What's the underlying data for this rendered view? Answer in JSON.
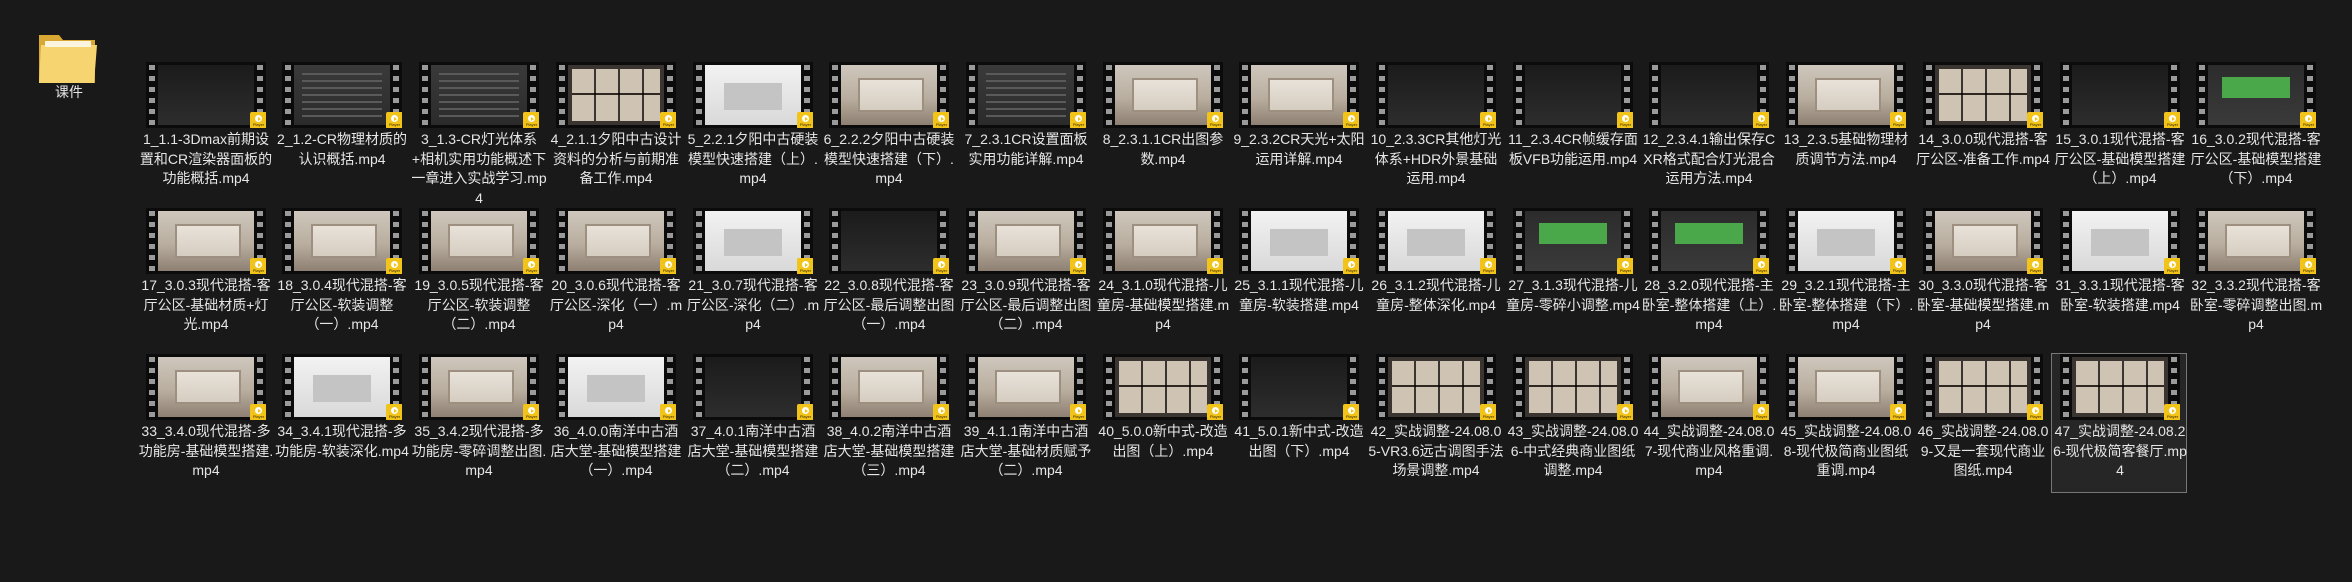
{
  "folder": {
    "name": "课件",
    "icon": "folder-icon"
  },
  "badge_text": "Player",
  "selected_index": 46,
  "files": [
    {
      "name": "1_1.1-3Dmax前期设置和CR渲染器面板的功能概括.mp4",
      "scene": "dark"
    },
    {
      "name": "2_1.2-CR物理材质的认识概括.mp4",
      "scene": "ui"
    },
    {
      "name": "3_1.3-CR灯光体系+相机实用功能概述下一章进入实战学习.mp4",
      "scene": "ui"
    },
    {
      "name": "4_2.1.1夕阳中古设计资料的分析与前期准备工作.mp4",
      "scene": "grid"
    },
    {
      "name": "5_2.2.1夕阳中古硬装模型快速搭建（上）.mp4",
      "scene": "white"
    },
    {
      "name": "6_2.2.2夕阳中古硬装模型快速搭建（下）.mp4",
      "scene": "room"
    },
    {
      "name": "7_2.3.1CR设置面板实用功能详解.mp4",
      "scene": "ui"
    },
    {
      "name": "8_2.3.1.1CR出图参数.mp4",
      "scene": "room"
    },
    {
      "name": "9_2.3.2CR天光+太阳运用详解.mp4",
      "scene": "room"
    },
    {
      "name": "10_2.3.3CR其他灯光体系+HDR外景基础运用.mp4",
      "scene": "dark"
    },
    {
      "name": "11_2.3.4CR帧缓存面板VFB功能运用.mp4",
      "scene": "dark"
    },
    {
      "name": "12_2.3.4.1输出保存CXR格式配合灯光混合运用方法.mp4",
      "scene": "dark"
    },
    {
      "name": "13_2.3.5基础物理材质调节方法.mp4",
      "scene": "room"
    },
    {
      "name": "14_3.0.0现代混搭-客厅公区-准备工作.mp4",
      "scene": "grid"
    },
    {
      "name": "15_3.0.1现代混搭-客厅公区-基础模型搭建（上）.mp4",
      "scene": "dark"
    },
    {
      "name": "16_3.0.2现代混搭-客厅公区-基础模型搭建（下）.mp4",
      "scene": "green"
    },
    {
      "name": "17_3.0.3现代混搭-客厅公区-基础材质+灯光.mp4",
      "scene": "room"
    },
    {
      "name": "18_3.0.4现代混搭-客厅公区-软装调整（一）.mp4",
      "scene": "room"
    },
    {
      "name": "19_3.0.5现代混搭-客厅公区-软装调整（二）.mp4",
      "scene": "room"
    },
    {
      "name": "20_3.0.6现代混搭-客厅公区-深化（一）.mp4",
      "scene": "room"
    },
    {
      "name": "21_3.0.7现代混搭-客厅公区-深化（二）.mp4",
      "scene": "white"
    },
    {
      "name": "22_3.0.8现代混搭-客厅公区-最后调整出图（一）.mp4",
      "scene": "dark"
    },
    {
      "name": "23_3.0.9现代混搭-客厅公区-最后调整出图（二）.mp4",
      "scene": "room"
    },
    {
      "name": "24_3.1.0现代混搭-儿童房-基础模型搭建.mp4",
      "scene": "room"
    },
    {
      "name": "25_3.1.1现代混搭-儿童房-软装搭建.mp4",
      "scene": "white"
    },
    {
      "name": "26_3.1.2现代混搭-儿童房-整体深化.mp4",
      "scene": "white"
    },
    {
      "name": "27_3.1.3现代混搭-儿童房-零碎小调整.mp4",
      "scene": "green"
    },
    {
      "name": "28_3.2.0现代混搭-主卧室-整体搭建（上）.mp4",
      "scene": "green"
    },
    {
      "name": "29_3.2.1现代混搭-主卧室-整体搭建（下）.mp4",
      "scene": "white"
    },
    {
      "name": "30_3.3.0现代混搭-客卧室-基础模型搭建.mp4",
      "scene": "room"
    },
    {
      "name": "31_3.3.1现代混搭-客卧室-软装搭建.mp4",
      "scene": "white"
    },
    {
      "name": "32_3.3.2现代混搭-客卧室-零碎调整出图.mp4",
      "scene": "room"
    },
    {
      "name": "33_3.4.0现代混搭-多功能房-基础模型搭建.mp4",
      "scene": "room"
    },
    {
      "name": "34_3.4.1现代混搭-多功能房-软装深化.mp4",
      "scene": "white"
    },
    {
      "name": "35_3.4.2现代混搭-多功能房-零碎调整出图.mp4",
      "scene": "room"
    },
    {
      "name": "36_4.0.0南洋中古酒店大堂-基础模型搭建（一）.mp4",
      "scene": "white"
    },
    {
      "name": "37_4.0.1南洋中古酒店大堂-基础模型搭建（二）.mp4",
      "scene": "dark"
    },
    {
      "name": "38_4.0.2南洋中古酒店大堂-基础模型搭建（三）.mp4",
      "scene": "room"
    },
    {
      "name": "39_4.1.1南洋中古酒店大堂-基础材质赋予（二）.mp4",
      "scene": "room"
    },
    {
      "name": "40_5.0.0新中式-改造出图（上）.mp4",
      "scene": "grid"
    },
    {
      "name": "41_5.0.1新中式-改造出图（下）.mp4",
      "scene": "dark"
    },
    {
      "name": "42_实战调整-24.08.05-VR3.6远古调图手法场景调整.mp4",
      "scene": "grid"
    },
    {
      "name": "43_实战调整-24.08.06-中式经典商业图纸调整.mp4",
      "scene": "grid"
    },
    {
      "name": "44_实战调整-24.08.07-现代商业风格重调.mp4",
      "scene": "room"
    },
    {
      "name": "45_实战调整-24.08.08-现代极简商业图纸重调.mp4",
      "scene": "room"
    },
    {
      "name": "46_实战调整-24.08.09-又是一套现代商业图纸.mp4",
      "scene": "grid"
    },
    {
      "name": "47_实战调整-24.08.26-现代极简客餐厅.mp4",
      "scene": "grid"
    }
  ]
}
